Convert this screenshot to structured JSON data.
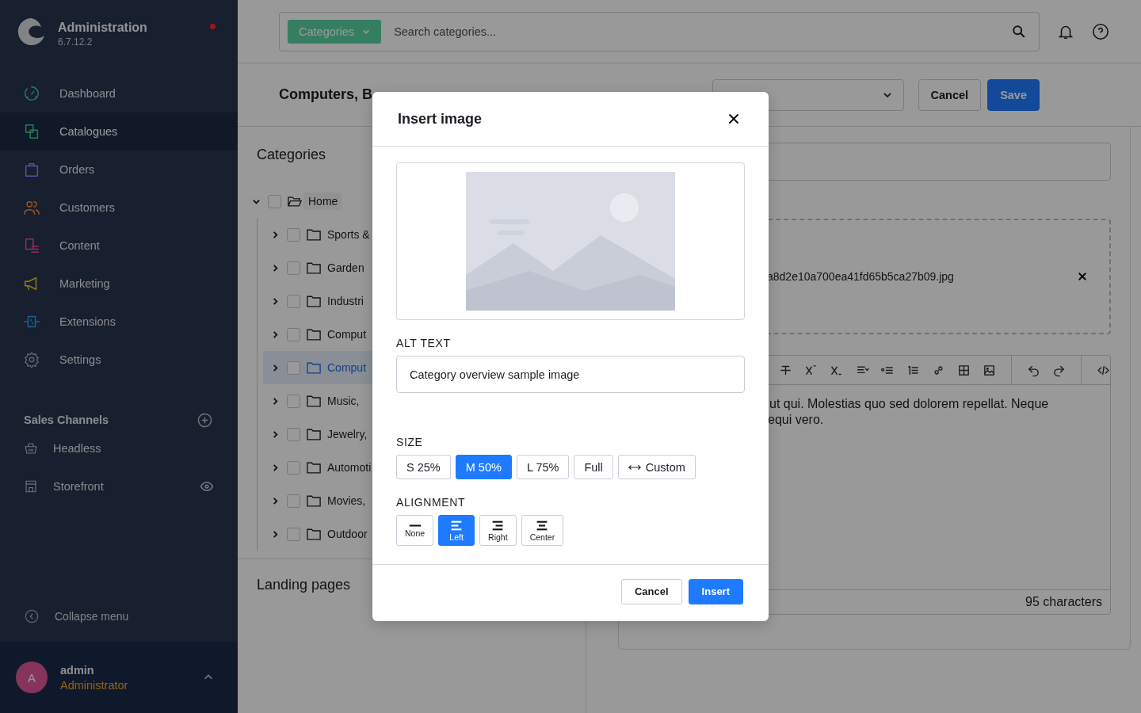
{
  "sidebar": {
    "app_title": "Administration",
    "version": "6.7.12.2",
    "items": [
      {
        "label": "Dashboard",
        "selected": false
      },
      {
        "label": "Catalogues",
        "selected": true
      },
      {
        "label": "Orders",
        "selected": false
      },
      {
        "label": "Customers",
        "selected": false
      },
      {
        "label": "Content",
        "selected": false
      },
      {
        "label": "Marketing",
        "selected": false
      },
      {
        "label": "Extensions",
        "selected": false
      },
      {
        "label": "Settings",
        "selected": false
      }
    ],
    "sales_channels": {
      "title": "Sales Channels",
      "items": [
        {
          "label": "Headless"
        },
        {
          "label": "Storefront"
        }
      ]
    },
    "collapse": "Collapse menu",
    "user": {
      "initial": "A",
      "name": "admin",
      "role": "Administrator"
    }
  },
  "topbar": {
    "search_scope": "Categories",
    "search_placeholder": "Search categories..."
  },
  "header": {
    "title": "Computers, B",
    "actions": [
      "Cancel",
      "Save"
    ]
  },
  "categories": {
    "title": "Categories",
    "tree": [
      {
        "label": "Home",
        "expanded": true,
        "checked": false,
        "selected": false,
        "children": [
          {
            "label": "Sports &",
            "expanded": false,
            "checked": false,
            "selected": false
          },
          {
            "label": "Garden",
            "expanded": false,
            "checked": false,
            "selected": false
          },
          {
            "label": "Industri",
            "expanded": false,
            "checked": false,
            "selected": false
          },
          {
            "label": "Comput",
            "expanded": false,
            "checked": false,
            "selected": false
          },
          {
            "label": "Comput",
            "expanded": false,
            "checked": false,
            "selected": true
          },
          {
            "label": "Music,",
            "expanded": false,
            "checked": false,
            "selected": false
          },
          {
            "label": "Jewelry,",
            "expanded": false,
            "checked": false,
            "selected": false
          },
          {
            "label": "Automoti",
            "expanded": false,
            "checked": false,
            "selected": false
          },
          {
            "label": "Movies,",
            "expanded": false,
            "checked": false,
            "selected": false
          },
          {
            "label": "Outdoor",
            "expanded": false,
            "checked": false,
            "selected": false
          }
        ]
      }
    ]
  },
  "landing_pages": {
    "title": "Landing pages"
  },
  "media": {
    "file_name": "a8d2e10a700ea41fd65b5ca27b09.jpg"
  },
  "editor": {
    "text_lines": [
      "ut qui. Molestias quo sed dolorem repellat. Neque",
      "equi vero."
    ],
    "char_count": "95 characters"
  },
  "dialog": {
    "title": "Insert image",
    "alt_label": "ALT TEXT",
    "alt_value": "Category overview sample image",
    "size_label": "SIZE",
    "sizes": [
      {
        "label": "S 25%",
        "kind": "preset",
        "selected": false
      },
      {
        "label": "M 50%",
        "kind": "preset",
        "selected": true
      },
      {
        "label": "L 75%",
        "kind": "preset",
        "selected": false
      },
      {
        "label": "Full",
        "kind": "preset",
        "selected": false
      },
      {
        "label": "Custom",
        "kind": "custom",
        "selected": false
      }
    ],
    "alignment_label": "ALIGNMENT",
    "alignments": [
      {
        "label": "None",
        "kind": "none",
        "selected": false
      },
      {
        "label": "Left",
        "kind": "left",
        "selected": true
      },
      {
        "label": "Right",
        "kind": "right",
        "selected": false
      },
      {
        "label": "Center",
        "kind": "center",
        "selected": false
      }
    ],
    "buttons": [
      "Cancel",
      "Insert"
    ]
  }
}
